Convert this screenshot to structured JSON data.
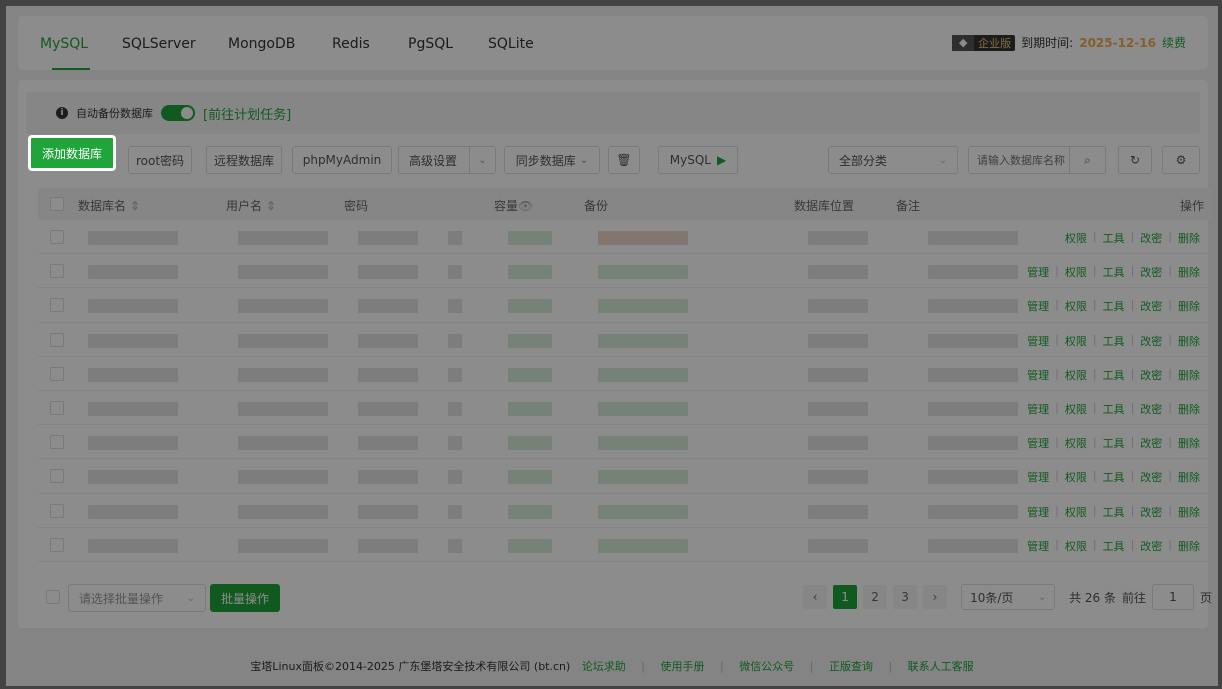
{
  "tabs": [
    "MySQL",
    "SQLServer",
    "MongoDB",
    "Redis",
    "PgSQL",
    "SQLite"
  ],
  "enterprise": {
    "badge_label": "企业版",
    "expire_label": "到期时间:",
    "expire_date": "2025-12-16",
    "renew_label": "续费"
  },
  "autobackup": {
    "label": "自动备份数据库",
    "link": "[前往计划任务]"
  },
  "toolbar": {
    "add_db": "添加数据库",
    "root_pwd": "root密码",
    "remote_db": "远程数据库",
    "phpmyadmin": "phpMyAdmin",
    "advanced": "高级设置",
    "sync_db": "同步数据库",
    "mysql": "MySQL",
    "category": "全部分类",
    "search_placeholder": "请输入数据库名称"
  },
  "columns": {
    "name": "数据库名",
    "user": "用户名",
    "password": "密码",
    "capacity": "容量",
    "backup": "备份",
    "location": "数据库位置",
    "remark": "备注",
    "ops": "操作"
  },
  "ops": {
    "manage": "管理",
    "perm": "权限",
    "tools": "工具",
    "chpwd": "改密",
    "delete": "删除"
  },
  "batch": {
    "placeholder": "请选择批量操作",
    "button": "批量操作"
  },
  "pager": {
    "pages": [
      "1",
      "2",
      "3"
    ],
    "per_page": "10条/页",
    "total": "共 26 条",
    "goto": "前往",
    "current": "1",
    "page_unit": "页"
  },
  "footer": {
    "copyright": "宝塔Linux面板©2014-2025 广东堡塔安全技术有限公司 (bt.cn)",
    "links": [
      "论坛求助",
      "使用手册",
      "微信公众号",
      "正版查询",
      "联系人工客服"
    ]
  }
}
